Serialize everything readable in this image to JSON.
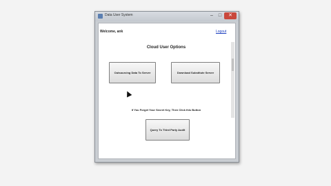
{
  "window": {
    "title": "Data User System",
    "minimize_glyph": "–",
    "maximize_glyph": "□",
    "close_glyph": "✕"
  },
  "header": {
    "welcome": "Welcome, ank",
    "logout": "Logout"
  },
  "main": {
    "heading": "Cloud User Options",
    "outsourcing_button": "Outsourcing Data To Server",
    "download_button": "Download Substitute Server",
    "forgot_text": "If You Forget Your Secret Key, Then Click this Button",
    "query_button": "Query To Third Party Audit"
  },
  "icons": {
    "app": "app-icon",
    "cursor": "mouse-pointer-icon"
  },
  "colors": {
    "link": "#1a3dbf",
    "close_button": "#c9483c"
  }
}
